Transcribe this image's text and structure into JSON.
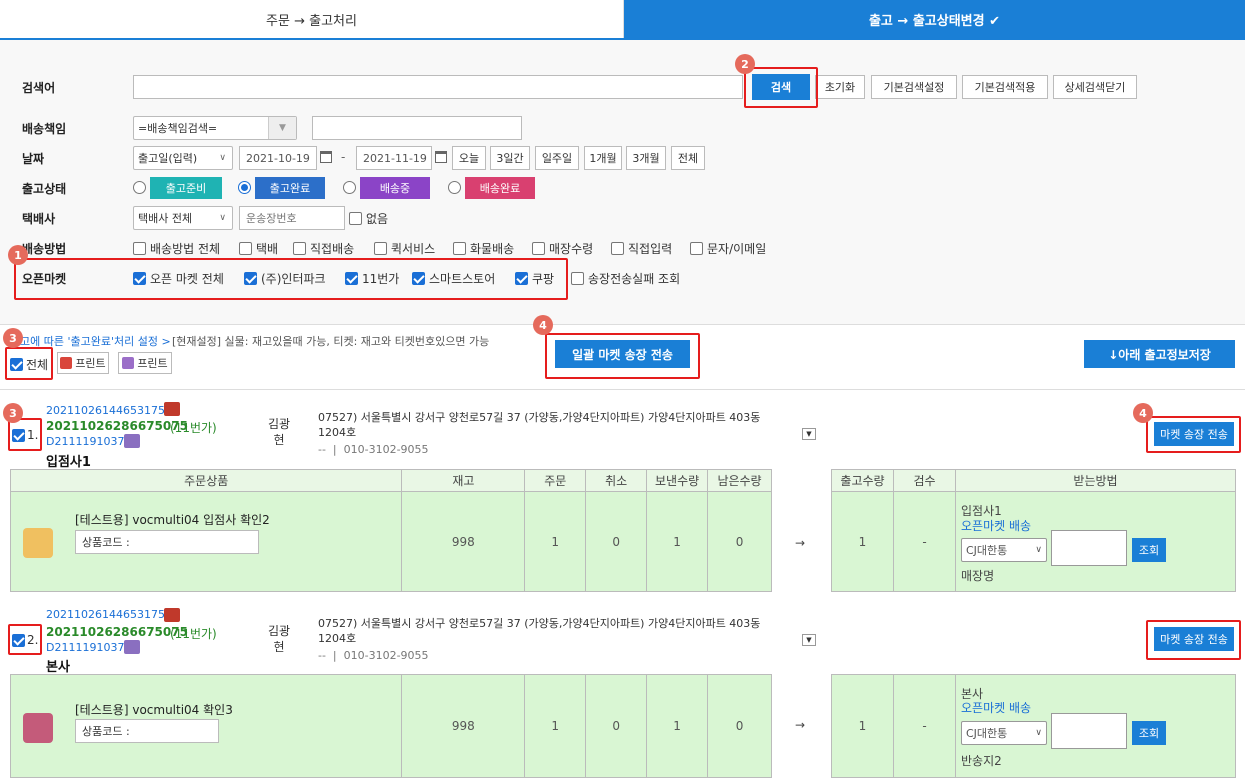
{
  "tabs": {
    "t1": "주문 → 출고처리",
    "t2": "출고 → 출고상태변경 ✔"
  },
  "search": {
    "keyword_label": "검색어",
    "search_btn": "검색",
    "reset_btn": "초기화",
    "basic_setting_btn": "기본검색설정",
    "basic_apply_btn": "기본검색적용",
    "detail_close_btn": "상세검색닫기",
    "delivery_label": "배송책임",
    "delivery_select": "=배송책임검색=",
    "date_label": "날짜",
    "date_type": "출고일(입력)",
    "date_from": "2021-10-19",
    "date_sep": "-",
    "date_to": "2021-11-19",
    "periods": [
      "오늘",
      "3일간",
      "일주일",
      "1개월",
      "3개월",
      "전체"
    ],
    "status_label": "출고상태",
    "statuses": [
      {
        "label": "출고준비",
        "color": "#1fb3b3"
      },
      {
        "label": "출고완료",
        "color": "#2c6fc9"
      },
      {
        "label": "배송중",
        "color": "#8b44c7"
      },
      {
        "label": "배송완료",
        "color": "#d94070"
      }
    ],
    "courier_label": "택배사",
    "courier_select": "택배사 전체",
    "invoice_placeholder": "운송장번호",
    "none_label": "없음",
    "method_label": "배송방법",
    "methods": [
      "배송방법 전체",
      "택배",
      "직접배송",
      "퀵서비스",
      "화물배송",
      "매장수령",
      "직접입력",
      "문자/이메일"
    ],
    "market_label": "오픈마켓",
    "markets": [
      "오픈 마켓 전체",
      "(주)인터파크",
      "11번가",
      "스마트스토어",
      "쿠팡"
    ],
    "fail_label": "송장전송실패 조회"
  },
  "badges": {
    "b1": "1",
    "b2": "2",
    "b3": "3",
    "b4": "4"
  },
  "mid": {
    "setting_link": "고에 따른 '출고완료'처리 설정 >",
    "setting_note": "[현재설정] 실물: 재고있을때 가능,   티켓: 재고와 티켓번호있으면 가능",
    "all_label": "전체",
    "print1": "프린트",
    "print2": "프린트",
    "bulk_send": "일괄 마켓 송장 전송",
    "save_below": "↓아래 출고정보저장"
  },
  "orders": [
    {
      "num": "1.",
      "order_no": "2021102614465317535",
      "market_no": "20211026286675075",
      "market_name": "(11번가)",
      "delivery_no": "D21111910373",
      "seller": "입점사1",
      "recipient": "김광\n현",
      "address": "07527) 서울특별시 강서구 양천로57길 37 (가양동,가양4단지아파트) 가양4단지아파트 403동 1204호",
      "phone": "--  |  010-3102-9055",
      "send_btn": "마켓 송장 전송",
      "product": "[테스트용] vocmulti04 입점사 확인2",
      "code_label": "상품코드 :",
      "stock": "998",
      "ordered": "1",
      "cancel": "0",
      "return": "1",
      "remain": "0",
      "arrow": "→",
      "out_qty": "1",
      "inspect": "-",
      "recv_seller": "입점사1",
      "recv_method": "오픈마켓 배송",
      "courier": "CJ대한통",
      "query_btn": "조회",
      "store": "매장명"
    },
    {
      "num": "2.",
      "order_no": "2021102614465317535",
      "market_no": "20211026286675075",
      "market_name": "(11번가)",
      "delivery_no": "D21111910372",
      "seller": "본사",
      "recipient": "김광\n현",
      "address": "07527) 서울특별시 강서구 양천로57길 37 (가양동,가양4단지아파트) 가양4단지아파트 403동 1204호",
      "phone": "--  |  010-3102-9055",
      "send_btn": "마켓 송장 전송",
      "product": "[테스트용] vocmulti04 확인3",
      "code_label": "상품코드 :",
      "stock": "998",
      "ordered": "1",
      "cancel": "0",
      "return": "1",
      "remain": "0",
      "arrow": "→",
      "out_qty": "1",
      "inspect": "-",
      "recv_seller": "본사",
      "recv_method": "오픈마켓 배송",
      "courier": "CJ대한통",
      "query_btn": "조회",
      "store": "반송지2"
    }
  ],
  "table_headers": {
    "product": "주문상품",
    "stock": "재고",
    "order": "주문",
    "cancel": "취소",
    "return": "보낸수량",
    "remain": "남은수량",
    "out": "출고수량",
    "inspect": "검수",
    "recv": "받는방법"
  }
}
